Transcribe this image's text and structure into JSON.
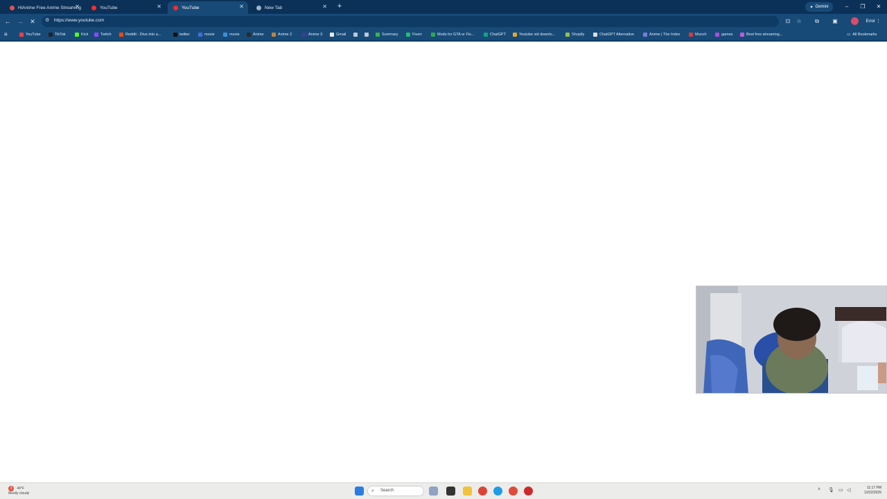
{
  "browser": {
    "tabs": [
      {
        "label": "HiAnime Free Anime Streaming",
        "favicon_color": "#e05252",
        "active": false
      },
      {
        "label": "YouTube",
        "favicon_color": "#ff2a2a",
        "active": false
      },
      {
        "label": "YouTube",
        "favicon_color": "#ff2a2a",
        "active": true
      },
      {
        "label": "New Tab",
        "favicon_color": "#9fb3c8",
        "active": false
      }
    ],
    "new_tab_symbol": "+",
    "gemini_label": "Gemini",
    "window_controls": {
      "minimize": "–",
      "restore": "❐",
      "close": "✕"
    },
    "url": "https://www.youtube.com",
    "error_label": "Error",
    "loading": true
  },
  "bookmarks": [
    {
      "label": "YouTube",
      "color": "#ff3d3d"
    },
    {
      "label": "TikTok",
      "color": "#222222"
    },
    {
      "label": "Kick",
      "color": "#53fc18"
    },
    {
      "label": "Twitch",
      "color": "#9146ff"
    },
    {
      "label": "Reddit - Dive into a...",
      "color": "#ff4500"
    },
    {
      "label": "twitter",
      "color": "#111111"
    },
    {
      "label": "movie",
      "color": "#3b6fd8"
    },
    {
      "label": "movie",
      "color": "#3b8fd8"
    },
    {
      "label": "Anime",
      "color": "#2a2a2a"
    },
    {
      "label": "Anime 2",
      "color": "#c7823a"
    },
    {
      "label": "Anime 3",
      "color": "#3d3d8f"
    },
    {
      "label": "Gmail",
      "color": "#e8e8e8"
    },
    {
      "label": "",
      "color": "#bfc7d1"
    },
    {
      "label": "",
      "color": "#bfc7d1"
    },
    {
      "label": "Summary",
      "color": "#37b24d"
    },
    {
      "label": "Fiverr",
      "color": "#1dbf73"
    },
    {
      "label": "Mods for GTA or Fiv...",
      "color": "#2fa84f"
    },
    {
      "label": "ChatGPT",
      "color": "#10a37f"
    },
    {
      "label": "Youtube vid downlo...",
      "color": "#e0a82e"
    },
    {
      "label": "Shopify",
      "color": "#95bf47"
    },
    {
      "label": "ChatGPT Alternative",
      "color": "#dddddd"
    },
    {
      "label": "Anime | The Index",
      "color": "#7a7ad8"
    },
    {
      "label": "Munch",
      "color": "#d63a3a"
    },
    {
      "label": "games",
      "color": "#b04ad8"
    },
    {
      "label": "Best free streaming...",
      "color": "#c05ad8"
    }
  ],
  "all_bookmarks_label": "All Bookmarks",
  "taskbar": {
    "weather_temp": "44°F",
    "weather_text": "Mostly cloudy",
    "search_placeholder": "Search",
    "time": "11:17 PM",
    "date": "12/22/2025"
  }
}
